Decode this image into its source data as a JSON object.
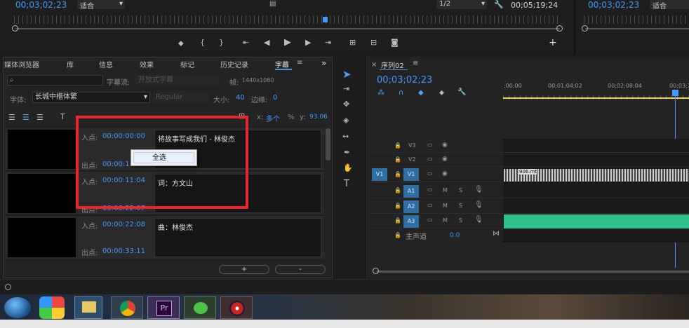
{
  "source_monitor": {
    "timecode": "00;03;02;23",
    "fit": "适合"
  },
  "program_monitor": {
    "page": "1/2",
    "duration": "00;05;19;24"
  },
  "right_monitor": {
    "timecode": "00;03;02;23",
    "fit": "适合"
  },
  "panel_tabs": [
    "媒体浏览器",
    "库",
    "信息",
    "效果",
    "标记",
    "历史记录",
    "字幕"
  ],
  "caption_panel": {
    "search_placeholder": "",
    "stream_label": "字幕流:",
    "stream_value": "开放式字幕",
    "frame_label": "帧:",
    "frame_value": "1440x1080",
    "font_label": "字体:",
    "font_value": "长城中楷体繁",
    "weight_value": "Regular",
    "size_label": "大小:",
    "size_value": "40",
    "edge_label": "边缘:",
    "edge_value": "0",
    "x_label": "x:",
    "x_value": "多个",
    "pct": "%",
    "y_label": "y:",
    "y_value": "93.06",
    "in_label": "入点:",
    "out_label": "出点:",
    "captions": [
      {
        "in": "00:00:00:00",
        "out": "00:00:11:",
        "text": "将故事写成我们 - 林俊杰"
      },
      {
        "in": "00:00:11:04",
        "out": "00:00:22:07",
        "text": "词：方文山"
      },
      {
        "in": "00:00:22:08",
        "out": "00:00:33:11",
        "text": "曲：林俊杰"
      }
    ],
    "add_button": "+",
    "remove_button": "-"
  },
  "context_menu": {
    "select_all": "全选"
  },
  "timeline": {
    "sequence_name": "序列02",
    "timecode": "00;03;02;23",
    "ruler": [
      ";00;00",
      "00;01;04;02",
      "00;02;08;04",
      "00;03;1"
    ],
    "tracks": [
      {
        "name": "V3",
        "type": "video"
      },
      {
        "name": "V2",
        "type": "video"
      },
      {
        "name": "V1",
        "type": "video",
        "source": "V1"
      },
      {
        "name": "A1",
        "type": "audio",
        "m": "M",
        "s": "S"
      },
      {
        "name": "A2",
        "type": "audio",
        "m": "M",
        "s": "S"
      },
      {
        "name": "A3",
        "type": "audio",
        "m": "M",
        "s": "S"
      }
    ],
    "master_label": "主声道",
    "master_value": "0.0",
    "clip_label": "906.mt"
  },
  "colors": {
    "accent": "#3f9bff",
    "highlight_box": "#e8262b",
    "audio_clip": "#2fbf8a",
    "taskbar": "#1e2a3a"
  }
}
